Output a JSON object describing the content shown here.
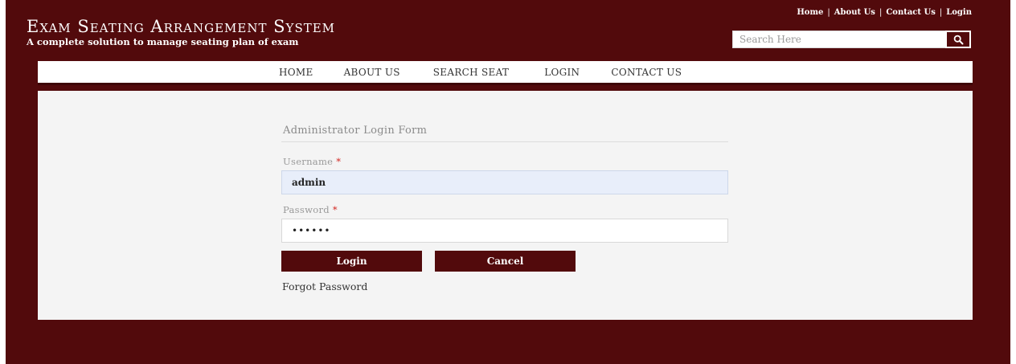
{
  "header": {
    "title": "Exam Seating Arrangement System",
    "subtitle": "A complete solution to manage seating plan of exam"
  },
  "top_links": [
    {
      "label": "Home"
    },
    {
      "label": "About Us"
    },
    {
      "label": "Contact Us"
    },
    {
      "label": "Login"
    }
  ],
  "search": {
    "placeholder": "Search Here",
    "icon": "search-icon"
  },
  "nav": [
    {
      "label": "HOME"
    },
    {
      "label": "ABOUT US"
    },
    {
      "label": "SEARCH SEAT"
    },
    {
      "label": "LOGIN"
    },
    {
      "label": "CONTACT US"
    }
  ],
  "form": {
    "title": "Administrator Login Form",
    "username_label": "Username",
    "username_value": "admin",
    "password_label": "Password",
    "password_value": "••••••",
    "required_mark": "*",
    "login_label": "Login",
    "cancel_label": "Cancel",
    "forgot_label": "Forgot Password"
  },
  "colors": {
    "brand": "#520a0c",
    "content_bg": "#f4f4f4",
    "autofill_bg": "#e8eefa",
    "required": "#d2231d"
  }
}
